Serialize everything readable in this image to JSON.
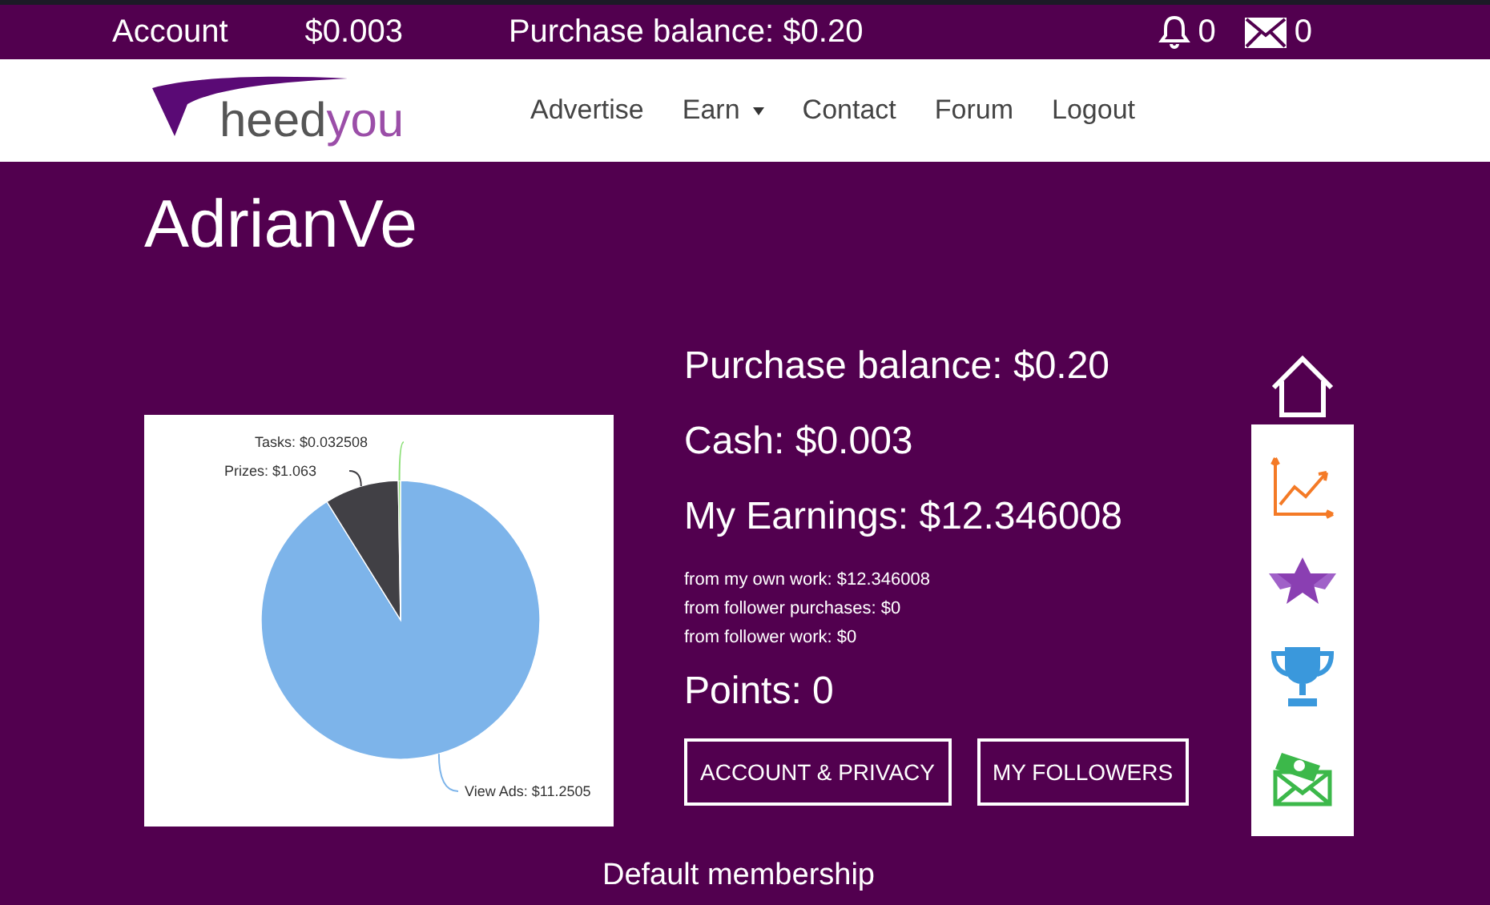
{
  "top_bar": {
    "account": "Account",
    "cash": "$0.003",
    "purchase_balance": "Purchase balance: $0.20",
    "notifications": "0",
    "messages": "0"
  },
  "nav": {
    "logo": {
      "part_1": "heed",
      "part_2": "you"
    },
    "links": [
      {
        "label": "Advertise",
        "dropdown": false
      },
      {
        "label": "Earn",
        "dropdown": true
      },
      {
        "label": "Contact",
        "dropdown": false
      },
      {
        "label": "Forum",
        "dropdown": false
      },
      {
        "label": "Logout",
        "dropdown": false
      }
    ]
  },
  "profile": {
    "username": "AdrianVe",
    "chart": {
      "chart_data": {
        "type": "pie",
        "series": [
          {
            "values": [
              91.13,
              8.61,
              0.26
            ]
          }
        ],
        "colors": [
          "#7db4ea",
          "#414045",
          "#8ee07a"
        ],
        "value_labels": [
          "View Ads: $11.2505",
          "Prizes: $1.063",
          "Tasks: $0.032508"
        ]
      }
    },
    "purchase_balance": "Purchase balance: $0.20",
    "cash": "Cash: $0.003",
    "earnings": "My Earnings: $12.346008",
    "earnings_breakdown": [
      "from my own work: $12.346008",
      "from follower purchases: $0",
      "from follower work: $0"
    ],
    "points": "Points: 0",
    "buttons": [
      "ACCOUNT & PRIVACY",
      "MY FOLLOWERS"
    ],
    "membership": "Default membership"
  },
  "side_icons": [
    {
      "kind": "home"
    },
    {
      "kind": "chart"
    },
    {
      "kind": "star"
    },
    {
      "kind": "trophy"
    },
    {
      "kind": "money"
    }
  ]
}
